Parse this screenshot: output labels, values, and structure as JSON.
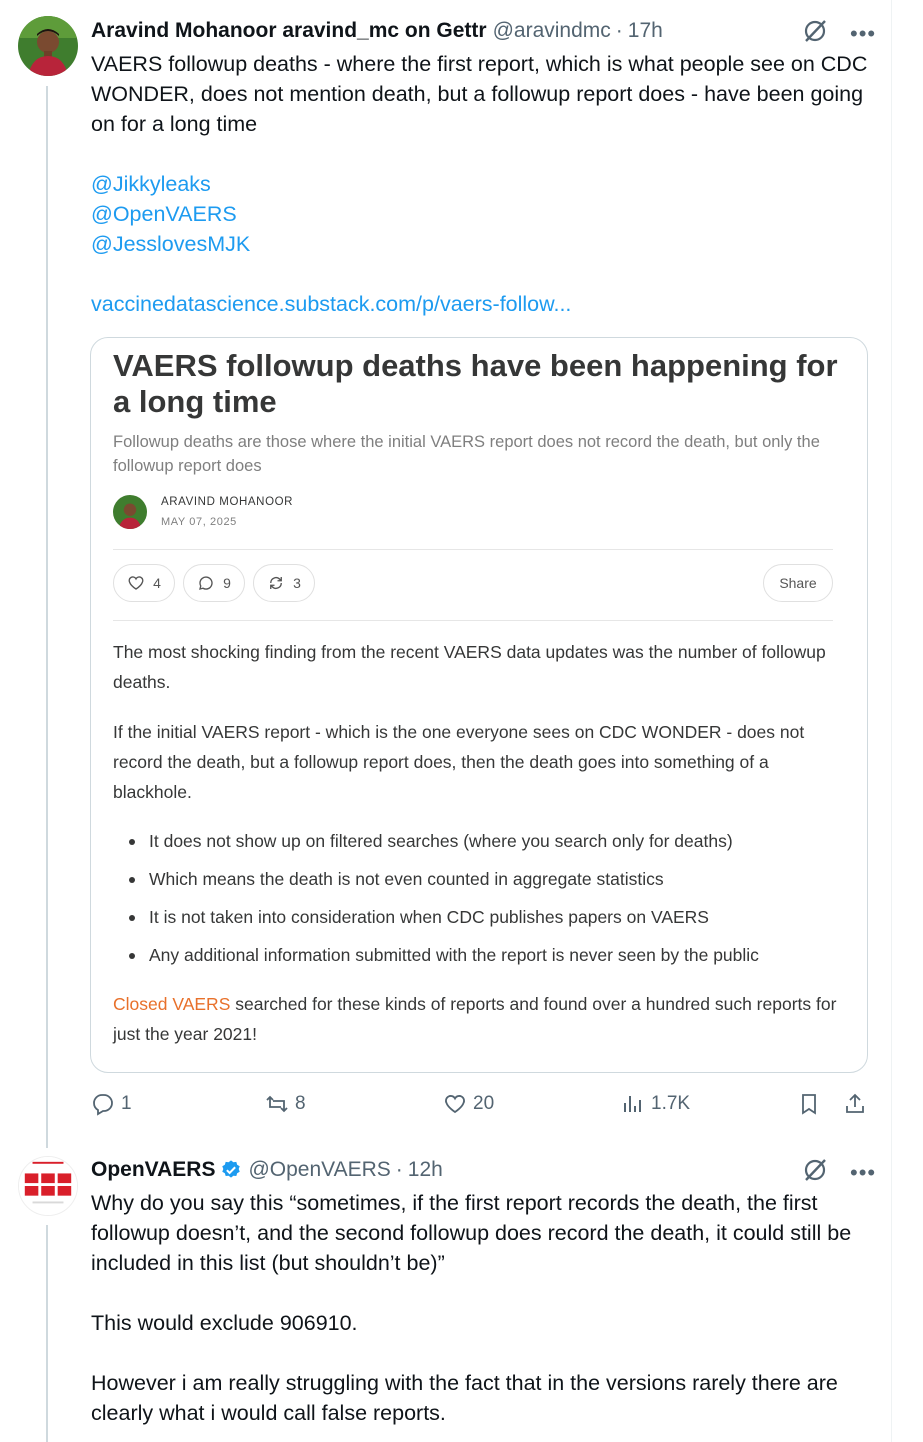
{
  "tweet1": {
    "display_name": "Aravind Mohanoor aravind_mc on Gettr",
    "handle": "@aravindmc",
    "time": "17h",
    "text": "VAERS followup deaths - where the first report, which is what people see on CDC WONDER, does not mention death, but a followup report does - have been going on for a long time",
    "mentions": [
      "@Jikkyleaks",
      "@OpenVAERS",
      "@JesslovesMJK"
    ],
    "link": "vaccinedatascience.substack.com/p/vaers-follow...",
    "card": {
      "title": "VAERS followup deaths have been happening for a long time",
      "subtitle": "Followup deaths are those where the initial VAERS report does not record the death, but only the followup report does",
      "author": "ARAVIND MOHANOOR",
      "date": "MAY 07, 2025",
      "likes": "4",
      "comments": "9",
      "restacks": "3",
      "share_label": "Share",
      "para1": "The most shocking finding from the recent VAERS data updates was the number of followup deaths.",
      "para2": "If the initial VAERS report - which is the one everyone sees on CDC WONDER - does not record the death, but a followup report does, then the death goes into something of a blackhole.",
      "bullets": [
        "It does not show up on filtered searches (where you search only for deaths)",
        "Which means the death is not even counted in aggregate statistics",
        "It is not taken into consideration when CDC publishes papers on VAERS",
        "Any additional information submitted with the report is never seen by the public"
      ],
      "para3_link": "Closed VAERS",
      "para3_rest": " searched for these kinds of reports and found over a hundred such reports for just the year 2021!"
    },
    "actions": {
      "replies": "1",
      "reposts": "8",
      "likes": "20",
      "views": "1.7K"
    }
  },
  "tweet2": {
    "display_name": "OpenVAERS",
    "handle": "@OpenVAERS",
    "time": "12h",
    "para1": "Why do you say this “sometimes, if the first report records the death, the first followup doesn’t, and the second followup does record the death, it could still be included in this list (but shouldn’t be)”",
    "para2": "This would exclude 906910.",
    "para3": "However i am really struggling with the fact that in the versions rarely there are clearly what i would call false reports."
  },
  "icons": [
    "grok-icon",
    "more-icon",
    "heart-icon",
    "comment-icon",
    "restack-icon",
    "reply-icon",
    "repost-icon",
    "like-icon",
    "views-icon",
    "bookmark-icon",
    "share-icon",
    "verified-badge-icon"
  ],
  "colors": {
    "link": "#1d9bf0",
    "muted": "#536471",
    "verified": "#1d9bf0",
    "substack_accent": "#e8702a",
    "openvaers_red": "#d91f2a"
  }
}
